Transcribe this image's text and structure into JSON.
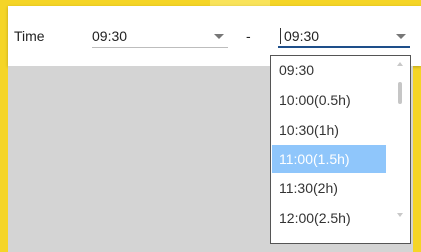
{
  "form": {
    "label": "Time",
    "start_value": "09:30",
    "separator": "-",
    "end_value": "09:30"
  },
  "dropdown": {
    "options": [
      "09:30",
      "10:00(0.5h)",
      "10:30(1h)",
      "11:00(1.5h)",
      "11:30(2h)",
      "12:00(2.5h)"
    ],
    "highlighted": "11:00(1.5h)"
  },
  "colors": {
    "background_accent": "#f5d526",
    "selected_option": "#8fc6fb",
    "active_underline": "#1e4f8a"
  },
  "icons": [
    "chevron-down-icon",
    "scroll-up-arrow-icon",
    "scroll-down-arrow-icon"
  ]
}
